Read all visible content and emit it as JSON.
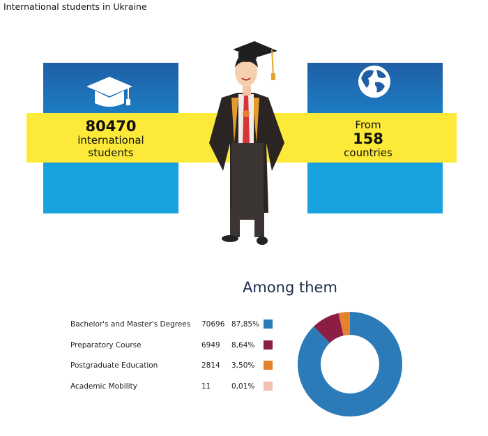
{
  "title": "International students in Ukraine",
  "stats": {
    "students": {
      "value": "80470",
      "line1": "international",
      "line2": "students",
      "icon": "graduation-cap-icon"
    },
    "countries": {
      "prefix": "From",
      "value": "158",
      "suffix": "countries",
      "icon": "globe-icon"
    }
  },
  "colors": {
    "blue_box": "#1b86cc",
    "yellow_band": "#fde937"
  },
  "chart_data": {
    "type": "pie",
    "donut": true,
    "title": "Among them",
    "categories": [
      "Bachelor's and Master's Degrees",
      "Preparatory Course",
      "Postgraduate Education",
      "Academic Mobility"
    ],
    "values": [
      70696,
      6949,
      2814,
      11
    ],
    "percents": [
      "87,85%",
      "8,64%",
      "3,50%",
      "0,01%"
    ],
    "colors": [
      "#2b7bb8",
      "#8b1e44",
      "#e5812c",
      "#f1c0b2"
    ],
    "legend": "left"
  }
}
